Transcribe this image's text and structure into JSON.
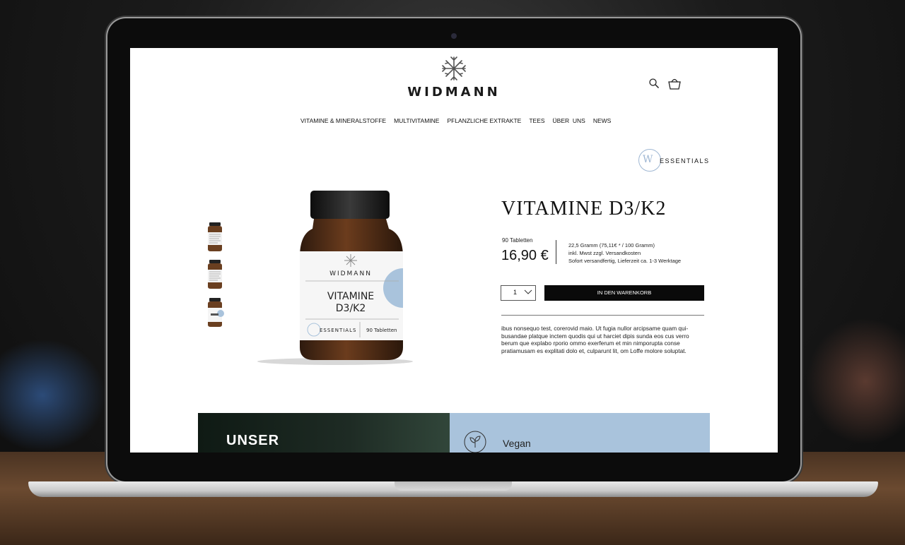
{
  "brand": {
    "name": "WIDMANN"
  },
  "nav": {
    "items": [
      "VITAMINE & MINERALSTOFFE",
      "MULTIVITAMINE",
      "PFLANZLICHE EXTRAKTE",
      "TEES",
      "ÜBER  UNS",
      "NEWS"
    ]
  },
  "essentials_badge": {
    "mark": "W",
    "label": "ESSENTIALS"
  },
  "product": {
    "title": "VITAMINE D3/K2",
    "quantity_label": "90 Tabletten",
    "price": "16,90 €",
    "info_lines": [
      "22,5 Gramm (75,11€ * / 100 Gramm)",
      "inkl. Mwst zzgl. Versandkosten",
      "Sofort versandfertig, Lieferzeit ca. 1-3 Werktage"
    ],
    "quantity_value": "1",
    "add_to_cart_label": "IN DEN WARENKORB",
    "description": "ibus nonsequo test, corerovid maio. Ut fugia nullor arcipsame quam qui-busandae platque inctem quodis qui ut harciet dipis sunda eos cus verro berum que explabo rporio ommo exerferum et min nimporupta conse pratiamusam es explitati dolo et, culparunt lit, om Loffe molore soluptat.",
    "jar_label": {
      "brand": "WIDMANN",
      "name_line1": "VITAMINE",
      "name_line2": "D3/K2",
      "essentials": "ESSENTIALS",
      "count": "90 Tabletten"
    }
  },
  "bottom": {
    "left_heading": "UNSER",
    "right_label": "Vegan"
  },
  "colors": {
    "accent_blue": "#a9c3dc",
    "dark": "#0a0a0a",
    "amber": "#4a2a16"
  }
}
